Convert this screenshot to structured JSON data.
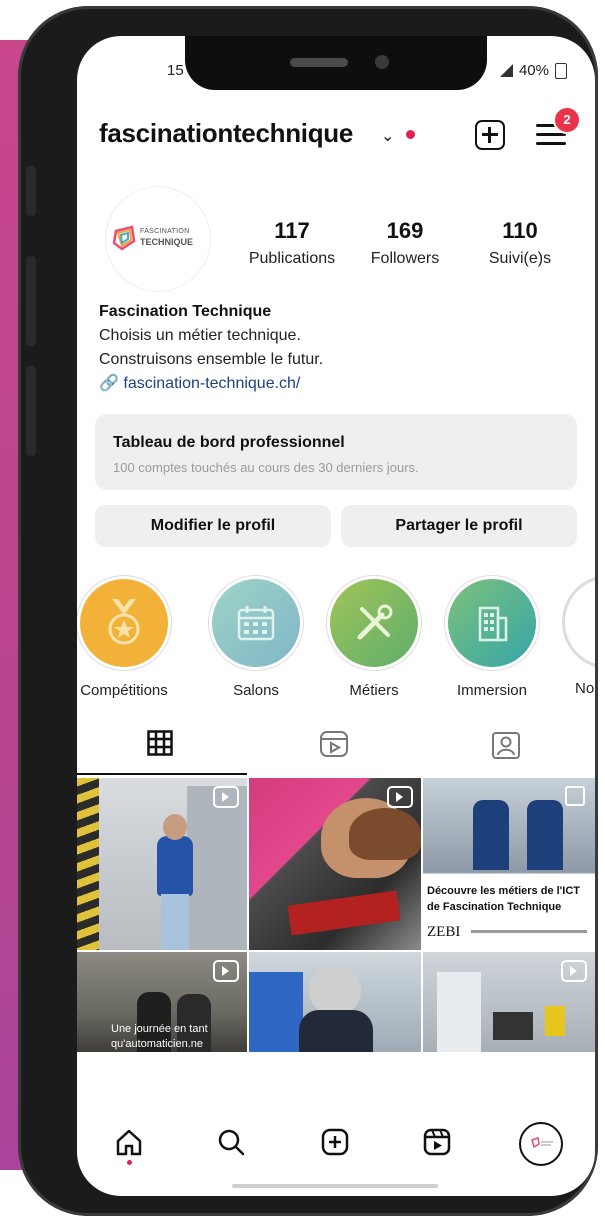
{
  "status": {
    "time": "15",
    "battery": "40%"
  },
  "header": {
    "username": "fascinationtechnique",
    "notification_count": "2"
  },
  "profile": {
    "logo_line1": "FASCINATION",
    "logo_line2": "TECHNIQUE",
    "stats": [
      {
        "value": "117",
        "label": "Publications"
      },
      {
        "value": "169",
        "label": "Followers"
      },
      {
        "value": "110",
        "label": "Suivi(e)s"
      }
    ],
    "bio": {
      "name": "Fascination Technique",
      "line1": "Choisis un métier technique.",
      "line2": "Construisons ensemble le futur.",
      "link": "fascination-technique.ch/"
    }
  },
  "dashboard": {
    "title": "Tableau de bord professionnel",
    "subtitle": "100 comptes touchés au cours des 30 derniers jours."
  },
  "buttons": {
    "edit": "Modifier le profil",
    "share": "Partager le profil"
  },
  "highlights": [
    {
      "label": "Compétitions",
      "color": "#f2b23a"
    },
    {
      "label": "Salons",
      "color": "#8fc9c0"
    },
    {
      "label": "Métiers",
      "color": "#7fb35c"
    },
    {
      "label": "Immersion",
      "color": "#5ab592"
    },
    {
      "label": "No"
    }
  ],
  "posts": {
    "post3_caption1": "Découvre les métiers de l'ICT",
    "post3_caption2": "de Fascination Technique",
    "post3_brand": "ZEBI",
    "post4_caption1": "Une journée en tant",
    "post4_caption2": "qu'automaticien.ne"
  }
}
